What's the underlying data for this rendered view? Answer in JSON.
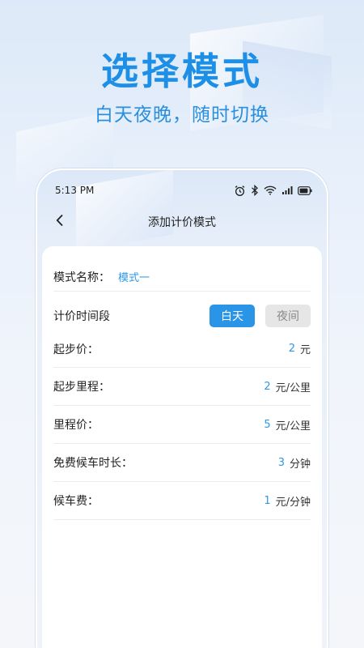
{
  "promo": {
    "headline": "选择模式",
    "subline": "白天夜晚，随时切换",
    "accent_color": "#1e8fe6"
  },
  "status_bar": {
    "time": "5:13 PM",
    "icons": [
      "alarm-icon",
      "bluetooth-icon",
      "wifi-icon",
      "signal-icon",
      "battery-icon"
    ]
  },
  "nav": {
    "back_icon": "chevron-left-icon",
    "title": "添加计价模式"
  },
  "form": {
    "mode_name_label": "模式名称：",
    "mode_name_value": "模式一",
    "period_label": "计价时间段",
    "period_options": [
      "白天",
      "夜间"
    ],
    "period_selected": "白天",
    "rows": [
      {
        "label": "起步价：",
        "value": "2",
        "unit": "元"
      },
      {
        "label": "起步里程：",
        "value": "2",
        "unit": "元/公里"
      },
      {
        "label": "里程价：",
        "value": "5",
        "unit": "元/公里"
      },
      {
        "label": "免费候车时长：",
        "value": "3",
        "unit": "分钟"
      },
      {
        "label": "候车费：",
        "value": "1",
        "unit": "元/分钟"
      }
    ]
  }
}
